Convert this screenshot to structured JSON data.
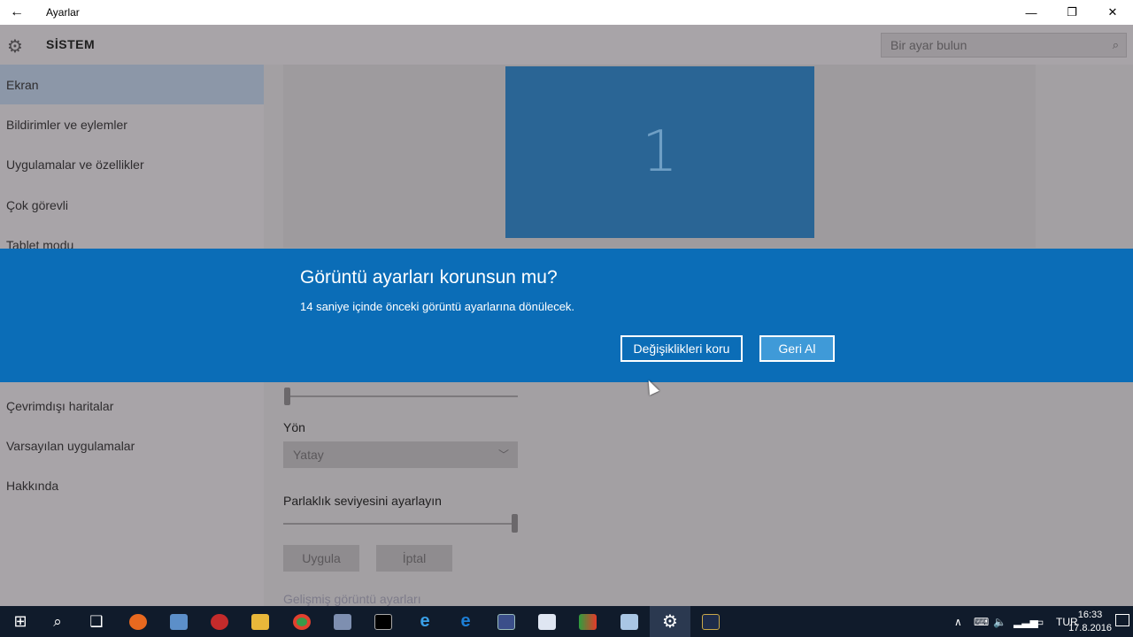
{
  "window": {
    "title": "Ayarlar",
    "back": "←",
    "minimize": "—",
    "restore": "❐",
    "close": "✕"
  },
  "header": {
    "section_title": "SİSTEM",
    "search_placeholder": "Bir ayar bulun"
  },
  "sidebar": {
    "items": [
      {
        "label": "Ekran",
        "active": true
      },
      {
        "label": "Bildirimler ve eylemler"
      },
      {
        "label": "Uygulamalar ve özellikler"
      },
      {
        "label": "Çok görevli"
      },
      {
        "label": "Tablet modu"
      },
      {
        "label": "Çevrimdışı haritalar"
      },
      {
        "label": "Varsayılan uygulamalar"
      },
      {
        "label": "Hakkında"
      }
    ]
  },
  "content": {
    "monitor_number": "1",
    "orientation_label": "Yön",
    "orientation_value": "Yatay",
    "brightness_label": "Parlaklık seviyesini ayarlayın",
    "brightness_level": 1.0,
    "apply_label": "Uygula",
    "cancel_label": "İptal",
    "advanced_link": "Gelişmiş görüntü ayarları"
  },
  "dialog": {
    "title": "Görüntü ayarları korunsun mu?",
    "message": "14 saniye içinde önceki görüntü ayarlarına dönülecek.",
    "keep_label": "Değişiklikleri koru",
    "revert_label": "Geri Al"
  },
  "taskbar": {
    "language": "TUR",
    "time": "16:33",
    "date": "17.8.2016",
    "colors": {
      "background": "#101b2b",
      "dialog": "#0b6db7"
    }
  }
}
